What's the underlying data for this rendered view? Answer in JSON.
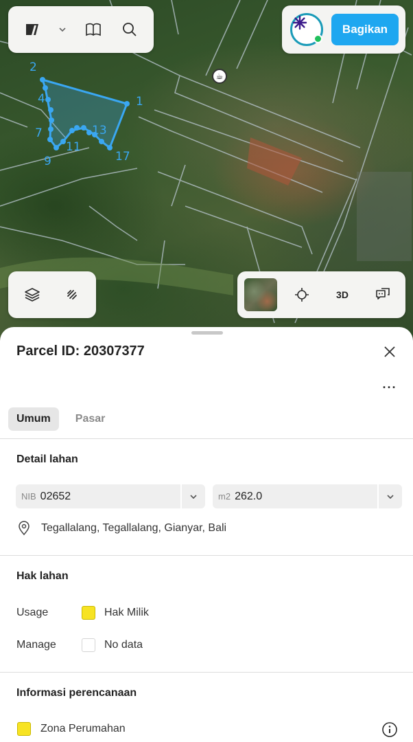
{
  "map": {
    "share_label": "Bagikan",
    "label_3d": "3D",
    "vertex_labels": [
      {
        "text": "2"
      },
      {
        "text": "4"
      },
      {
        "text": "1"
      },
      {
        "text": "7"
      },
      {
        "text": "13"
      },
      {
        "text": "11"
      },
      {
        "text": "9"
      },
      {
        "text": "17"
      }
    ],
    "icons": {
      "logo": "app-logo-icon",
      "dropdown": "chevron-down-icon",
      "book": "book-icon",
      "search": "search-icon",
      "layers": "layers-icon",
      "draw": "draw-line-icon",
      "locate": "crosshair-icon",
      "feedback": "chat-icon",
      "poi": "cafe-icon"
    },
    "parcel_color": "#3aa7f2",
    "share_color": "#1ea7f0",
    "online_color": "#20c05c"
  },
  "sheet": {
    "title": "Parcel ID: 20307377",
    "more_label": "···",
    "tabs": [
      {
        "label": "Umum",
        "active": true
      },
      {
        "label": "Pasar",
        "active": false
      }
    ],
    "detail": {
      "title": "Detail lahan",
      "nib_prefix": "NIB",
      "nib_value": "02652",
      "area_prefix": "m2",
      "area_value": "262.0",
      "location": "Tegallalang, Tegallalang, Gianyar, Bali"
    },
    "rights": {
      "title": "Hak lahan",
      "usage_label": "Usage",
      "usage_value": "Hak Milik",
      "usage_color": "#f7e323",
      "manage_label": "Manage",
      "manage_value": "No data",
      "manage_color": "#ffffff"
    },
    "planning": {
      "title": "Informasi perencanaan",
      "zone_label": "Zona Perumahan",
      "zone_color": "#f7e323"
    }
  }
}
